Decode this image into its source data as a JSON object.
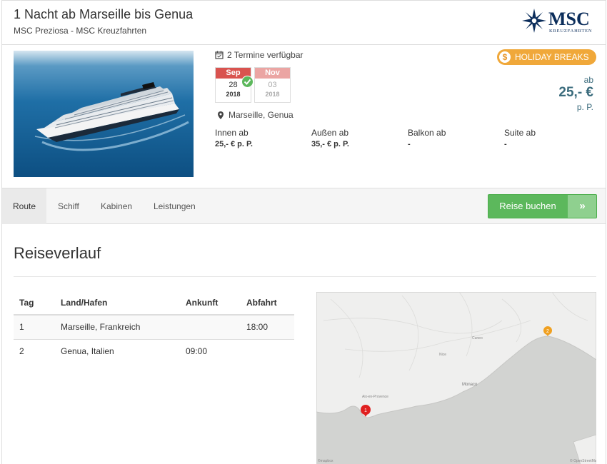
{
  "header": {
    "title": "1 Nacht ab Marseille bis Genua",
    "subtitle": "MSC Preziosa - MSC Kreuzfahrten",
    "logo_word": "MSC",
    "logo_sub": "KREUZFAHRTEN"
  },
  "dates": {
    "available_label": "2 Termine verfügbar",
    "items": [
      {
        "month": "Sep",
        "day": "28",
        "year": "2018",
        "selected": true
      },
      {
        "month": "Nov",
        "day": "03",
        "year": "2018",
        "selected": false
      }
    ]
  },
  "ports_label": "Marseille, Genua",
  "cabins": [
    {
      "label": "Innen ab",
      "value": "25,- € p. P."
    },
    {
      "label": "Außen ab",
      "value": "35,- € p. P."
    },
    {
      "label": "Balkon ab",
      "value": "-"
    },
    {
      "label": "Suite ab",
      "value": "-"
    }
  ],
  "badge": {
    "icon_text": "$",
    "label": "HOLIDAY BREAKS",
    "color": "#f0a83a"
  },
  "price": {
    "prefix": "ab",
    "value": "25,- €",
    "suffix": "p. P.",
    "color": "#3a6b7c"
  },
  "tabs": [
    {
      "label": "Route",
      "active": true
    },
    {
      "label": "Schiff",
      "active": false
    },
    {
      "label": "Kabinen",
      "active": false
    },
    {
      "label": "Leistungen",
      "active": false
    }
  ],
  "book_button": {
    "label": "Reise buchen",
    "icon": "double-chevron-right-icon",
    "color": "#5cb85c"
  },
  "itinerary": {
    "title": "Reiseverlauf",
    "columns": [
      "Tag",
      "Land/Hafen",
      "Ankunft",
      "Abfahrt"
    ],
    "rows": [
      {
        "day": "1",
        "port": "Marseille, Frankreich",
        "arrival": "",
        "departure": "18:00"
      },
      {
        "day": "2",
        "port": "Genua, Italien",
        "arrival": "09:00",
        "departure": ""
      }
    ]
  },
  "map": {
    "labels": [
      "Monaco",
      "Cuneo",
      "Nice",
      "Aix-en-Provence"
    ],
    "markers": [
      {
        "number": "1",
        "color": "#e02020"
      },
      {
        "number": "2",
        "color": "#f0a020"
      }
    ],
    "attribution_left": "©mapbox",
    "attribution_right": "© OpenStreetMap"
  }
}
